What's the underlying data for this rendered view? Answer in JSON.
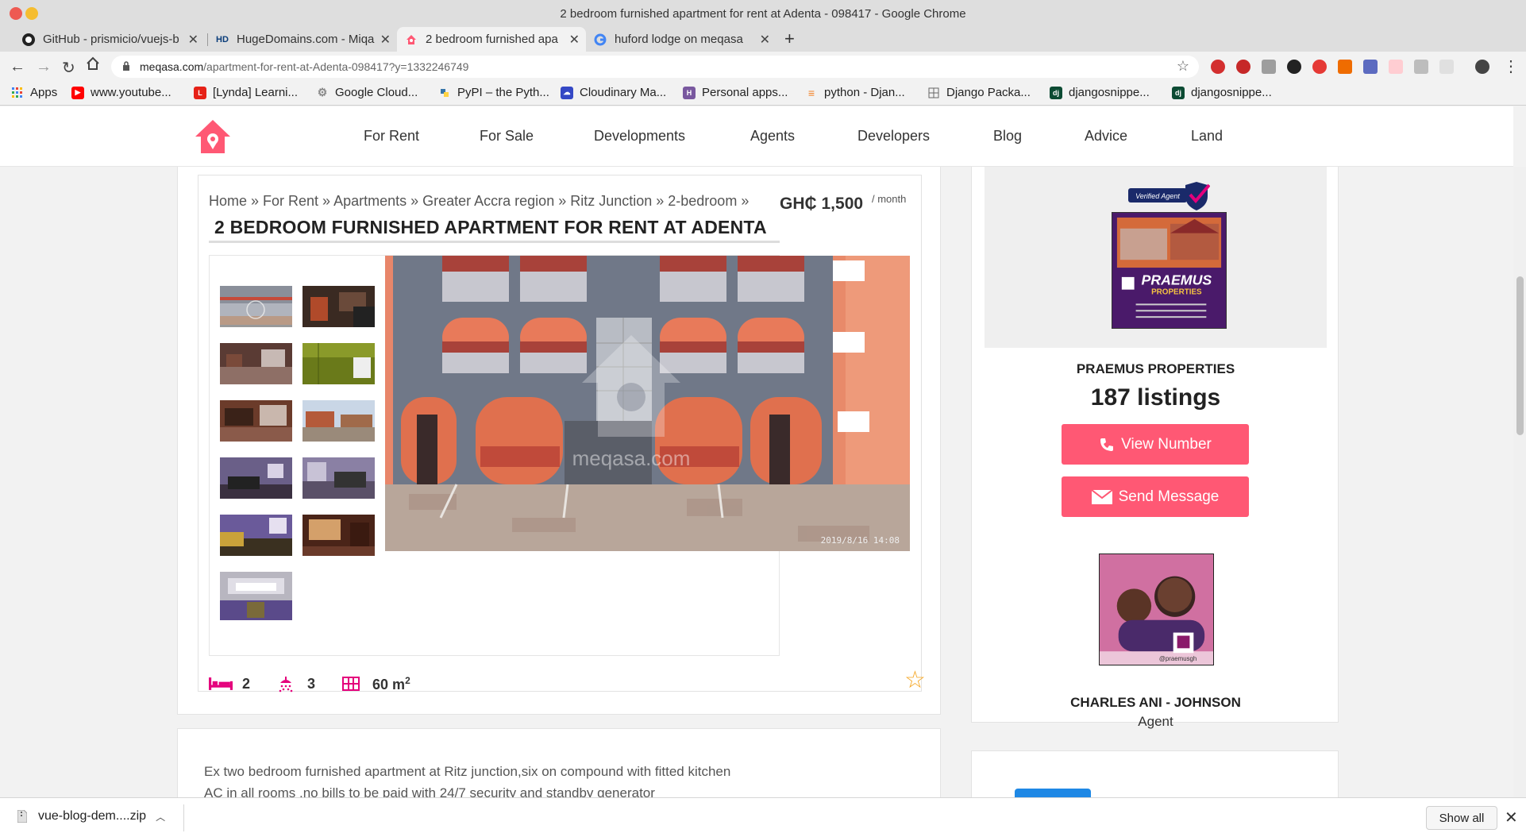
{
  "window": {
    "title": "2 bedroom furnished apartment for rent at Adenta - 098417 - Google Chrome"
  },
  "tabs": [
    {
      "label": "GitHub - prismicio/vuejs-b",
      "icon": "github-icon"
    },
    {
      "label": "HugeDomains.com - Miqa",
      "icon": "hugedomains-icon"
    },
    {
      "label": "2 bedroom furnished apa",
      "icon": "meqasa-icon",
      "active": true
    },
    {
      "label": "huford lodge on meqasa",
      "icon": "google-icon"
    }
  ],
  "omnibox": {
    "domain": "meqasa.com",
    "path": "/apartment-for-rent-at-Adenta-098417?y=1332246749"
  },
  "bookmarks": [
    {
      "label": "Apps",
      "icon": "apps-grid-icon",
      "color": "#4285f4"
    },
    {
      "label": "www.youtube...",
      "icon": "youtube-icon",
      "color": "#ff0000"
    },
    {
      "label": "[Lynda] Learni...",
      "icon": "lynda-icon",
      "color": "#e62117"
    },
    {
      "label": "Google Cloud...",
      "icon": "gear-icon",
      "color": "#888888"
    },
    {
      "label": "PyPI – the Pyth...",
      "icon": "pypi-icon",
      "color": "#ffd343"
    },
    {
      "label": "Cloudinary Ma...",
      "icon": "cloudinary-icon",
      "color": "#3448c5"
    },
    {
      "label": "Personal apps...",
      "icon": "heroku-icon",
      "color": "#79589f"
    },
    {
      "label": "python - Djan...",
      "icon": "stackoverflow-icon",
      "color": "#f48024"
    },
    {
      "label": "Django Packa...",
      "icon": "grid-icon",
      "color": "#666666"
    },
    {
      "label": "djangosnippe...",
      "icon": "django-icon",
      "color": "#0c4b33"
    },
    {
      "label": "djangosnippe...",
      "icon": "django-icon",
      "color": "#0c4b33"
    }
  ],
  "site": {
    "accent": "#ff5874",
    "nav": [
      "For Rent",
      "For Sale",
      "Developments",
      "Agents",
      "Developers",
      "Blog",
      "Advice",
      "Land"
    ]
  },
  "listing": {
    "breadcrumb": "Home » For Rent » Apartments » Greater Accra region » Ritz Junction » 2-bedroom »",
    "price": "GH₵ 1,500",
    "price_period": "/ month",
    "title": "2 BEDROOM FURNISHED APARTMENT FOR RENT AT ADENTA",
    "photo_timestamp": "2019/8/16  14:08",
    "watermark": "meqasa.com",
    "bedrooms": "2",
    "bathrooms": "3",
    "area": "60 m",
    "area_unit_sup": "2",
    "description": [
      "Ex two bedroom furnished apartment at Ritz junction,six on compound with fitted kitchen",
      "AC in all rooms ,no bills to be paid with 24/7 security and standby generator"
    ]
  },
  "agent": {
    "verified_label": "Verified Agent",
    "company": "PRAEMUS PROPERTIES",
    "company_logo_text": "PRAEMUS",
    "company_logo_sub": "PROPERTIES",
    "listings": "187 listings",
    "view_number": "View Number",
    "send_message": "Send Message",
    "name": "CHARLES ANI - JOHNSON",
    "role": "Agent",
    "handle": "@praemusgh"
  },
  "download": {
    "filename": "vue-blog-dem....zip",
    "show_all": "Show all"
  }
}
